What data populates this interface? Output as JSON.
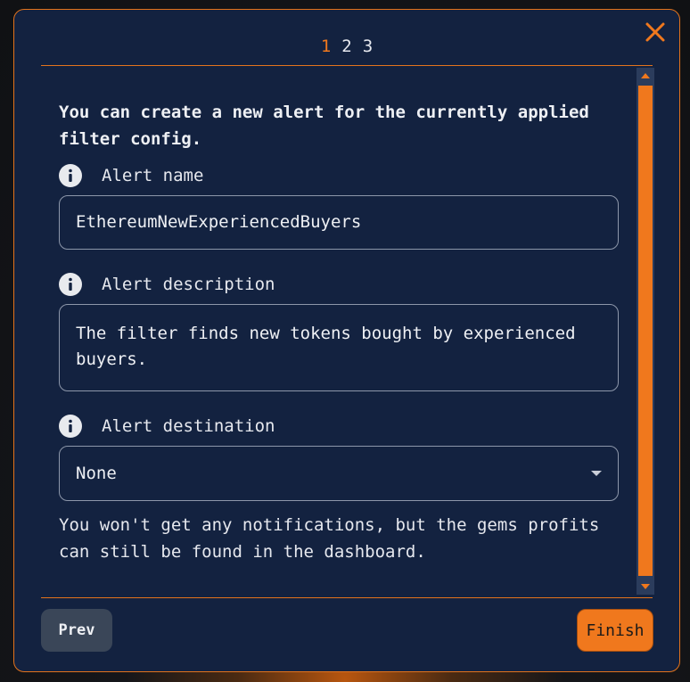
{
  "wizard": {
    "steps": [
      "1",
      "2",
      "3"
    ],
    "active_step": "1"
  },
  "intro_text": "You can create a new alert for the currently applied filter config.",
  "fields": {
    "name": {
      "label": "Alert name",
      "value": "EthereumNewExperiencedBuyers"
    },
    "description": {
      "label": "Alert description",
      "value": "The filter finds new tokens bought by experienced buyers."
    },
    "destination": {
      "label": "Alert destination",
      "value": "None"
    }
  },
  "hint_text": "You won't get any notifications, but the gems profits can still be found in the dashboard.",
  "buttons": {
    "prev": "Prev",
    "finish": "Finish"
  },
  "colors": {
    "accent": "#f0781d",
    "panel": "#132240"
  },
  "icons": {
    "close": "close-icon",
    "info": "info-icon",
    "dropdown": "chevron-down-icon"
  }
}
